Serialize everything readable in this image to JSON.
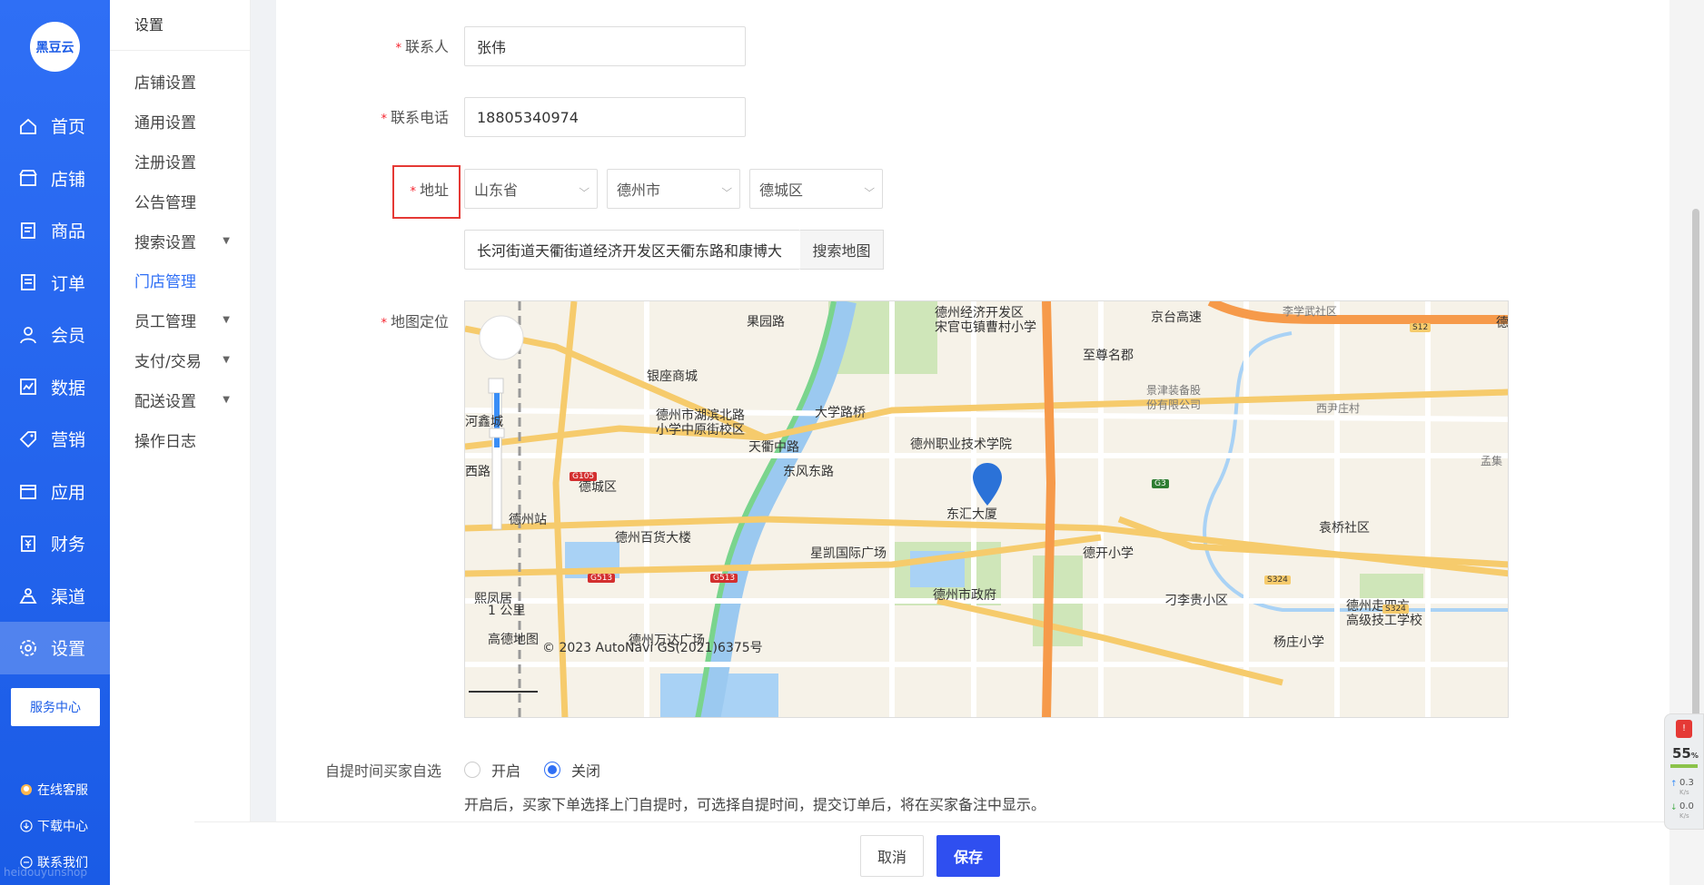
{
  "brand": {
    "logo_text": "黑豆云",
    "watermark": "heidouyunshop"
  },
  "nav": {
    "items": [
      {
        "label": "首页",
        "icon": "home-icon"
      },
      {
        "label": "店铺",
        "icon": "store-icon"
      },
      {
        "label": "商品",
        "icon": "goods-icon"
      },
      {
        "label": "订单",
        "icon": "order-icon"
      },
      {
        "label": "会员",
        "icon": "user-icon"
      },
      {
        "label": "数据",
        "icon": "chart-icon"
      },
      {
        "label": "营销",
        "icon": "tag-icon"
      },
      {
        "label": "应用",
        "icon": "app-icon"
      },
      {
        "label": "财务",
        "icon": "finance-icon"
      },
      {
        "label": "渠道",
        "icon": "channel-icon"
      },
      {
        "label": "设置",
        "icon": "gear-icon"
      }
    ],
    "active_index": 10,
    "service_center": "服务中心",
    "online_service": "在线客服",
    "download_center": "下载中心",
    "contact_us": "联系我们"
  },
  "submenu": {
    "title": "设置",
    "items": [
      {
        "label": "店铺设置",
        "has_caret": false
      },
      {
        "label": "通用设置",
        "has_caret": false
      },
      {
        "label": "注册设置",
        "has_caret": false
      },
      {
        "label": "公告管理",
        "has_caret": false
      },
      {
        "label": "搜索设置",
        "has_caret": true
      },
      {
        "label": "门店管理",
        "has_caret": false
      },
      {
        "label": "员工管理",
        "has_caret": true
      },
      {
        "label": "支付/交易",
        "has_caret": true
      },
      {
        "label": "配送设置",
        "has_caret": true
      },
      {
        "label": "操作日志",
        "has_caret": false
      }
    ],
    "active_index": 5
  },
  "form": {
    "contact": {
      "label": "联系人",
      "value": "张伟"
    },
    "phone": {
      "label": "联系电话",
      "value": "18805340974"
    },
    "address": {
      "label": "地址",
      "province": "山东省",
      "city": "德州市",
      "district": "德城区",
      "detail": "长河街道天衢街道经济开发区天衢东路和康博大",
      "search_button": "搜索地图"
    },
    "map_label": "地图定位",
    "pickup": {
      "label": "自提时间买家自选",
      "options": [
        "开启",
        "关闭"
      ],
      "selected": "关闭",
      "hint": "开启后，买家下单选择上门自提时，可选择自提时间，提交订单后，将在买家备注中显示。"
    }
  },
  "map": {
    "places": [
      {
        "text": "德州经济开发区\n宋官屯镇曹村小学",
        "cls": ""
      },
      {
        "text": "至尊名郡"
      },
      {
        "text": "银座商城"
      },
      {
        "text": "大学路桥"
      },
      {
        "text": "景津装备股\n份有限公司",
        "cls": "small"
      },
      {
        "text": "西尹庄村",
        "cls": "small"
      },
      {
        "text": "李学武社区",
        "cls": "small"
      },
      {
        "text": "德州市湖滨北路\n小学中原街校区"
      },
      {
        "text": "天衢中路"
      },
      {
        "text": "德州职业技术学院"
      },
      {
        "text": "河鑫城"
      },
      {
        "text": "德城区"
      },
      {
        "text": "德州站"
      },
      {
        "text": "东汇大厦"
      },
      {
        "text": "袁桥社区"
      },
      {
        "text": "德州百货大楼"
      },
      {
        "text": "星凯国际广场"
      },
      {
        "text": "德开小学"
      },
      {
        "text": "德州市政府"
      },
      {
        "text": "刁李贵小区"
      },
      {
        "text": "德州走四方\n高级技工学校"
      },
      {
        "text": "杨庄小学"
      },
      {
        "text": "德州万达广场"
      },
      {
        "text": "熙凤居"
      },
      {
        "text": "1 公里"
      },
      {
        "text": "高德地图"
      },
      {
        "text": "© 2023 AutoNavi GS(2021)6375号"
      },
      {
        "text": "西路"
      },
      {
        "text": "果园路"
      },
      {
        "text": "京台高速"
      },
      {
        "text": "孟集",
        "cls": "small"
      },
      {
        "text": "德"
      },
      {
        "text": "东风东路"
      }
    ],
    "road_badges": [
      "G105",
      "G513",
      "G513",
      "G3",
      "S12",
      "S324",
      "S324"
    ]
  },
  "footer": {
    "cancel": "取消",
    "save": "保存"
  },
  "widget": {
    "percent": "55",
    "up": "0.3",
    "down": "0.0",
    "unit": "K/s"
  }
}
